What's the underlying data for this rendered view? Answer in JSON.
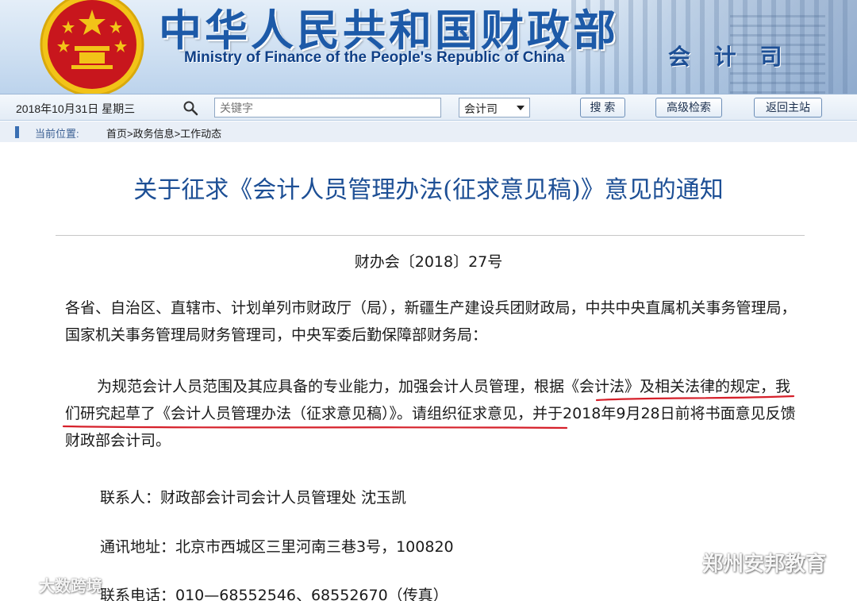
{
  "banner": {
    "title_cn": "中华人民共和国财政部",
    "title_en": "Ministry of Finance of the People's Republic of China",
    "department": "会 计 司"
  },
  "toolbar": {
    "date": "2018年10月31日  星期三",
    "search_placeholder": "关键字",
    "scope_selected": "会计司",
    "search_button": "搜 索",
    "advanced_button": "高级检索",
    "home_button": "返回主站"
  },
  "breadcrumb": {
    "label": "当前位置:",
    "path": "首页>政务信息>工作动态"
  },
  "article": {
    "title": "关于征求《会计人员管理办法(征求意见稿)》意见的通知",
    "doc_number": "财办会〔2018〕27号",
    "recipients": "各省、自治区、直辖市、计划单列市财政厅（局），新疆生产建设兵团财政局，中共中央直属机关事务管理局，国家机关事务管理局财务管理司，中央军委后勤保障部财务局：",
    "body": "为规范会计人员范围及其应具备的专业能力，加强会计人员管理，根据《会计法》及相关法律的规定，我们研究起草了《会计人员管理办法（征求意见稿）》。请组织征求意见，并于2018年9月28日前将书面意见反馈财政部会计司。",
    "contact": "联系人：财政部会计司会计人员管理处 沈玉凯",
    "address": "通讯地址：北京市西城区三里河南三巷3号，100820",
    "phone": "联系电话：010—68552546、68552670（传真）"
  },
  "watermarks": {
    "left": "大数跨境",
    "right": "郑州安邦教育"
  },
  "icons": {
    "emblem": "national-emblem-icon",
    "search": "search-icon",
    "dropdown": "chevron-down-icon",
    "wechat": "wechat-icon"
  },
  "colors": {
    "brand_blue": "#1d4f95",
    "highlight_underline": "#d6202a",
    "emblem_red": "#c8161d",
    "emblem_gold": "#f2c318"
  }
}
